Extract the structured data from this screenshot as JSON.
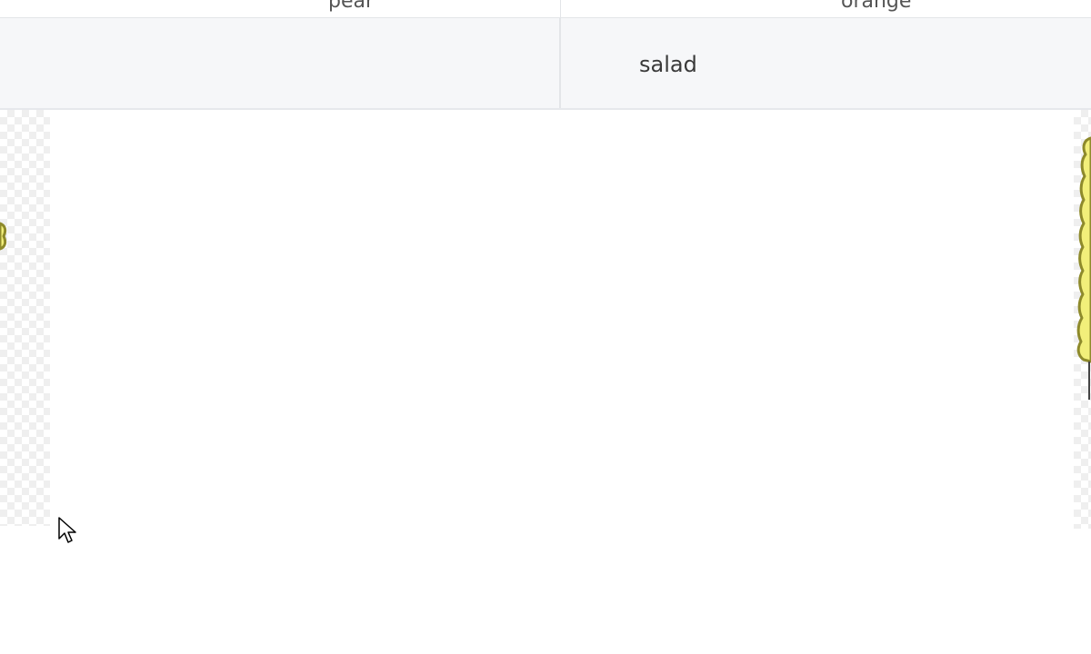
{
  "table": {
    "header": {
      "left_label": "pear",
      "right_label": "orange"
    },
    "row": {
      "right_cell_label": "salad"
    }
  },
  "colors": {
    "shape_fill": "#f2ef7a",
    "shape_stroke": "#8e8a2b",
    "grid_line": "#e3e5e8",
    "row_background": "#f6f7f9"
  },
  "icons": {
    "cursor": "mouse-pointer-icon"
  }
}
